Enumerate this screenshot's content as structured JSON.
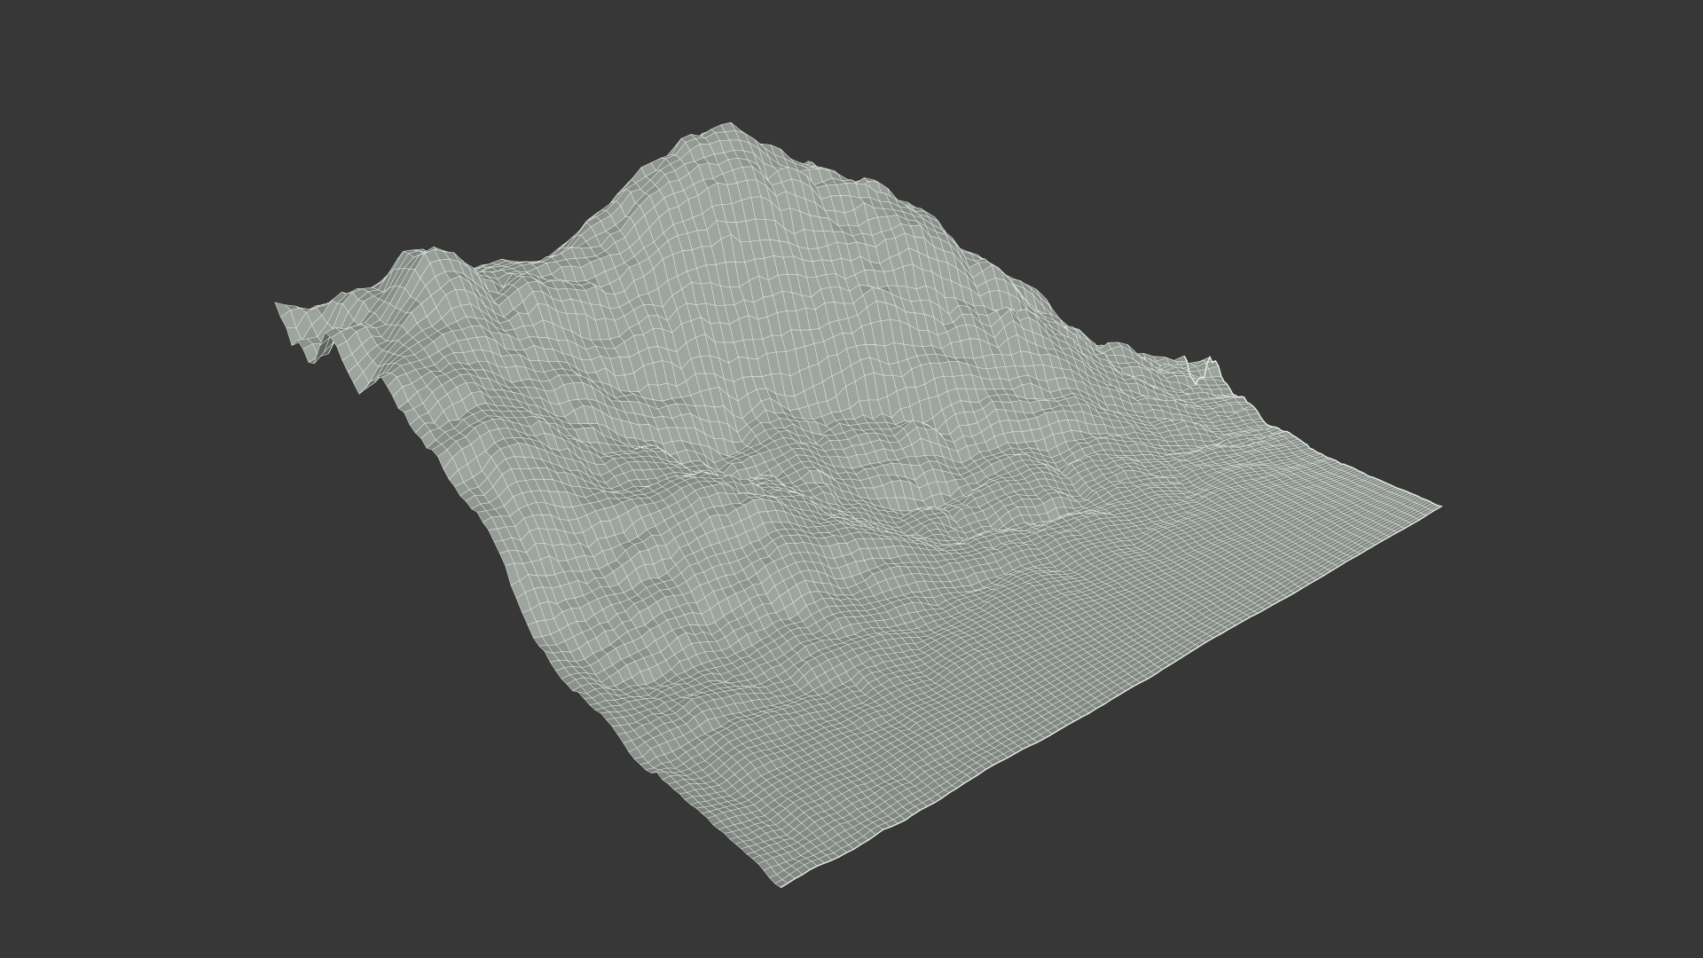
{
  "scene": {
    "background_color": "#373737",
    "mesh_fill_color": "#8a918a",
    "mesh_shadow_color": "#2f332f",
    "wire_color": "#e9efe7",
    "render_style": "wireframe-terrain"
  }
}
